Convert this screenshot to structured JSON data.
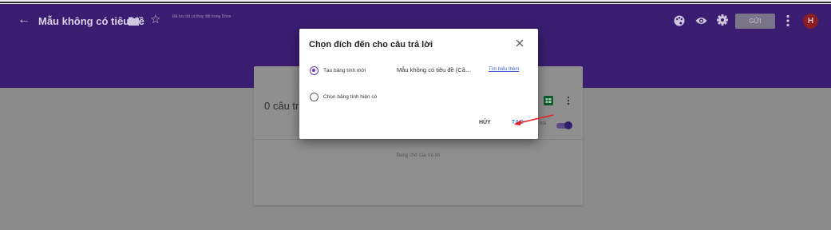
{
  "header": {
    "title": "Mẫu không có tiêu đề",
    "saved_note": "Đã lưu tất cả thay đổi trong Drive",
    "send_label": "GỬI",
    "avatar_initial": "H",
    "icons": [
      "back-icon",
      "folder-icon",
      "star-icon",
      "palette-icon",
      "eye-icon",
      "gear-icon",
      "more-vert-icon"
    ],
    "accent_color": "#673ab7"
  },
  "card": {
    "response_count": "0 câu tr",
    "accepting_label": "n hồi",
    "waiting_text": "Đang chờ câu trả lời"
  },
  "dialog": {
    "title": "Chọn đích đến cho câu trả lời",
    "option_new_label": "Tạo bảng tính mới",
    "new_sheet_name": "Mẫu không có tiêu đề (Câ…",
    "learn_more": "Tìm hiểu thêm",
    "option_existing_label": "Chọn bảng tính hiện có",
    "cancel_label": "HỦY",
    "create_label": "TẠO",
    "selected_option": "new"
  }
}
